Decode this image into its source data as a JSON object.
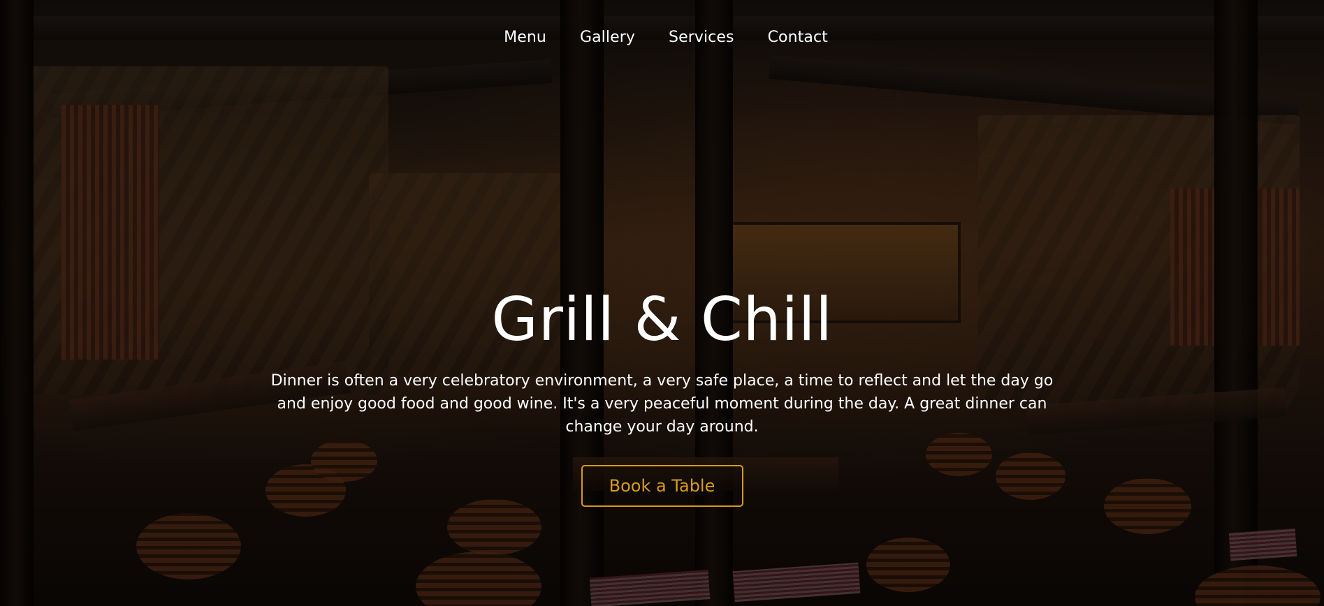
{
  "navigation": {
    "items": [
      {
        "label": "Menu"
      },
      {
        "label": "Gallery"
      },
      {
        "label": "Services"
      },
      {
        "label": "Contact"
      }
    ]
  },
  "hero": {
    "title": "Grill & Chill",
    "description": "Dinner is often a very celebratory environment, a very safe place, a time to reflect and let the day go and enjoy good food and good wine. It's a very peaceful moment during the day. A great dinner can change your day around.",
    "cta_label": "Book a Table"
  },
  "colors": {
    "text": "#ffffff",
    "accent": "#d89a1b",
    "overlay": "rgba(0, 0, 0, 0.48)"
  },
  "background_image": {
    "icon": "restaurant-interior-icon"
  }
}
